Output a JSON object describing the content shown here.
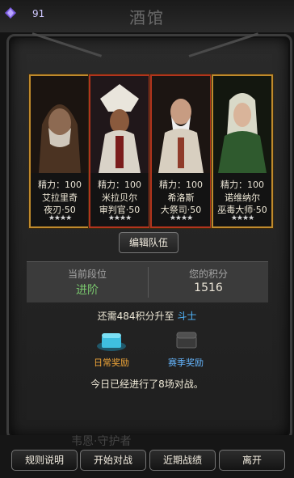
{
  "header": {
    "gem_count": "91",
    "title": "酒馆"
  },
  "heroes": [
    {
      "energy": "精力：100",
      "name": "艾拉里奇",
      "title": "夜刃·50",
      "stars": "★★★★",
      "frame_color": "#bf8a2c"
    },
    {
      "energy": "精力：100",
      "name": "米拉贝尔",
      "title": "审判官·50",
      "stars": "★★★★",
      "frame_color": "#b2341d"
    },
    {
      "energy": "精力：100",
      "name": "希洛斯",
      "title": "大祭司·50",
      "stars": "★★★★",
      "frame_color": "#b2341d"
    },
    {
      "energy": "精力：100",
      "name": "诺维纳尔",
      "title": "巫毒大师·50",
      "stars": "★★★★",
      "frame_color": "#bf8a2c"
    }
  ],
  "edit_team_label": "编辑队伍",
  "rank_panel": {
    "current_label": "当前段位",
    "current_value": "进阶",
    "score_label": "您的积分",
    "score_value": "1516"
  },
  "need": {
    "prefix": "还需484积分升至",
    "target": "斗士"
  },
  "rewards": {
    "daily_label": "日常奖励",
    "season_label": "赛季奖励"
  },
  "today_text": "今日已经进行了8场对战。",
  "background_text": "韦恩·守护者",
  "buttons": {
    "rules": "规则说明",
    "start": "开始对战",
    "recent": "近期战绩",
    "leave": "离开"
  }
}
